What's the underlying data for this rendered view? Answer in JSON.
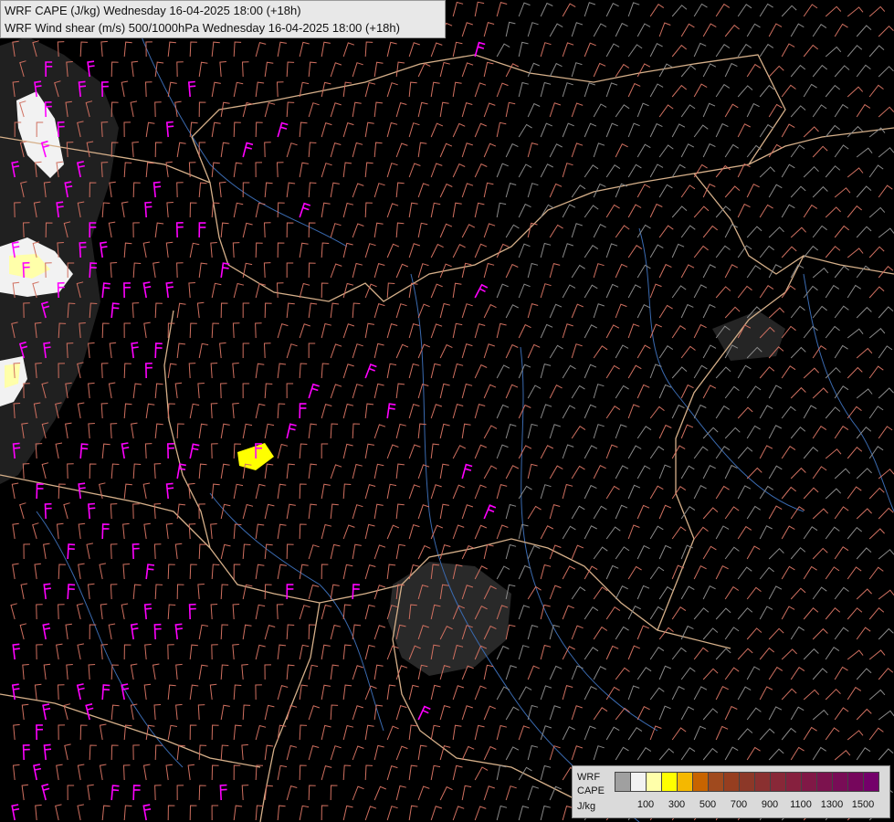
{
  "title": {
    "line1": "WRF CAPE (J/kg) Wednesday 16-04-2025 18:00 (+18h)",
    "line2": "WRF Wind shear (m/s) 500/1000hPa Wednesday 16-04-2025 18:00 (+18h)"
  },
  "legend": {
    "label_line1": "WRF",
    "label_line2": "CAPE",
    "label_line3": "J/kg",
    "colors": [
      "#a0a0a0",
      "#f2f2f2",
      "#ffffaa",
      "#ffff00",
      "#f5b800",
      "#c86400",
      "#a04a1e",
      "#963e20",
      "#8c3828",
      "#8a3030",
      "#882838",
      "#86203e",
      "#801846",
      "#7c124e",
      "#780c56",
      "#76065c",
      "#74006a"
    ],
    "tick_labels": [
      "100",
      "300",
      "500",
      "700",
      "900",
      "1100",
      "1300",
      "1500"
    ]
  },
  "layers": {
    "cape_fill": "cape-overlay",
    "wind_barbs": "wind-shear-barbs",
    "borders": "country-borders",
    "rivers": "rivers"
  },
  "barb_colors": {
    "low": "#8a8a8a",
    "mid": "#d07060",
    "high": "#ff00ff"
  }
}
